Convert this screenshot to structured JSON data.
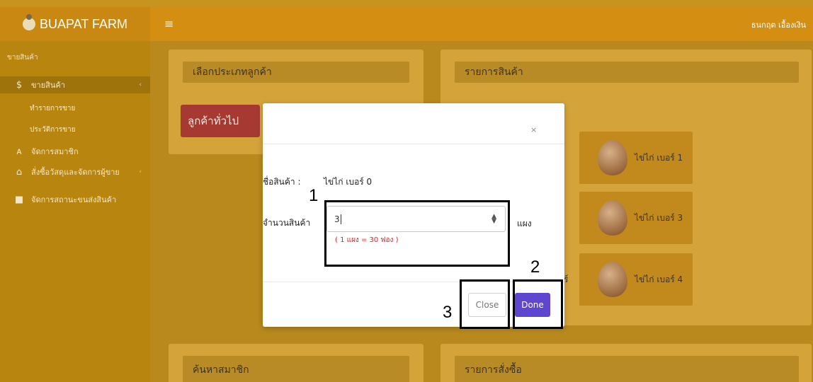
{
  "brand": {
    "name": "BUAPAT FARM"
  },
  "topbar": {
    "menu_icon": "hamburger-icon",
    "user_name": "ธนกฤต เอื้องเงิน"
  },
  "sidebar": {
    "header": "ขายสินค้า",
    "items": [
      {
        "icon": "dollar-icon",
        "glyph": "$",
        "label": "ขายสินค้า",
        "active": true
      },
      {
        "icon": "user-icon",
        "glyph": "ᴀ",
        "label": "จัดการสมาชิก"
      },
      {
        "icon": "folder-icon",
        "glyph": "⌂",
        "label": "สั่งซื้อวัสดุและจัดการผู้ขาย"
      },
      {
        "icon": "truck-icon",
        "glyph": "■",
        "label": "จัดการสถานะขนส่งสินค้า"
      }
    ],
    "subitems": [
      {
        "label": "ทำรายการขาย"
      },
      {
        "label": "ประวัติการขาย"
      }
    ]
  },
  "main": {
    "customer_type_title": "เลือกประเภทลูกค้า",
    "general_customer_button": "ลูกค้าทั่วไป",
    "product_list_title": "รายการสินค้า",
    "products": [
      {
        "label": "ไข่ไก่ เบอร์ 1"
      },
      {
        "label": "ไข่ไก่ เบอร์ 3"
      },
      {
        "label": "ไข่ไก่ เบอร์ 4"
      }
    ],
    "partial_label": "ร์",
    "search_member_title": "ค้นหาสมาชิก",
    "order_list_title": "รายการสั่งซื้อ"
  },
  "modal": {
    "close_x": "×",
    "product_name_label": "ชื่อสินค้า :",
    "product_name_value": "ไข่ไก่ เบอร์ 0",
    "quantity_label": "จำนวนสินค้า",
    "quantity_value": "3",
    "quantity_note": "( 1 แผง = 30 ฟอง )",
    "unit": "แผง",
    "close_button": "Close",
    "done_button": "Done",
    "accent": "#5f46d1"
  },
  "annotations": [
    "1",
    "2",
    "3"
  ]
}
